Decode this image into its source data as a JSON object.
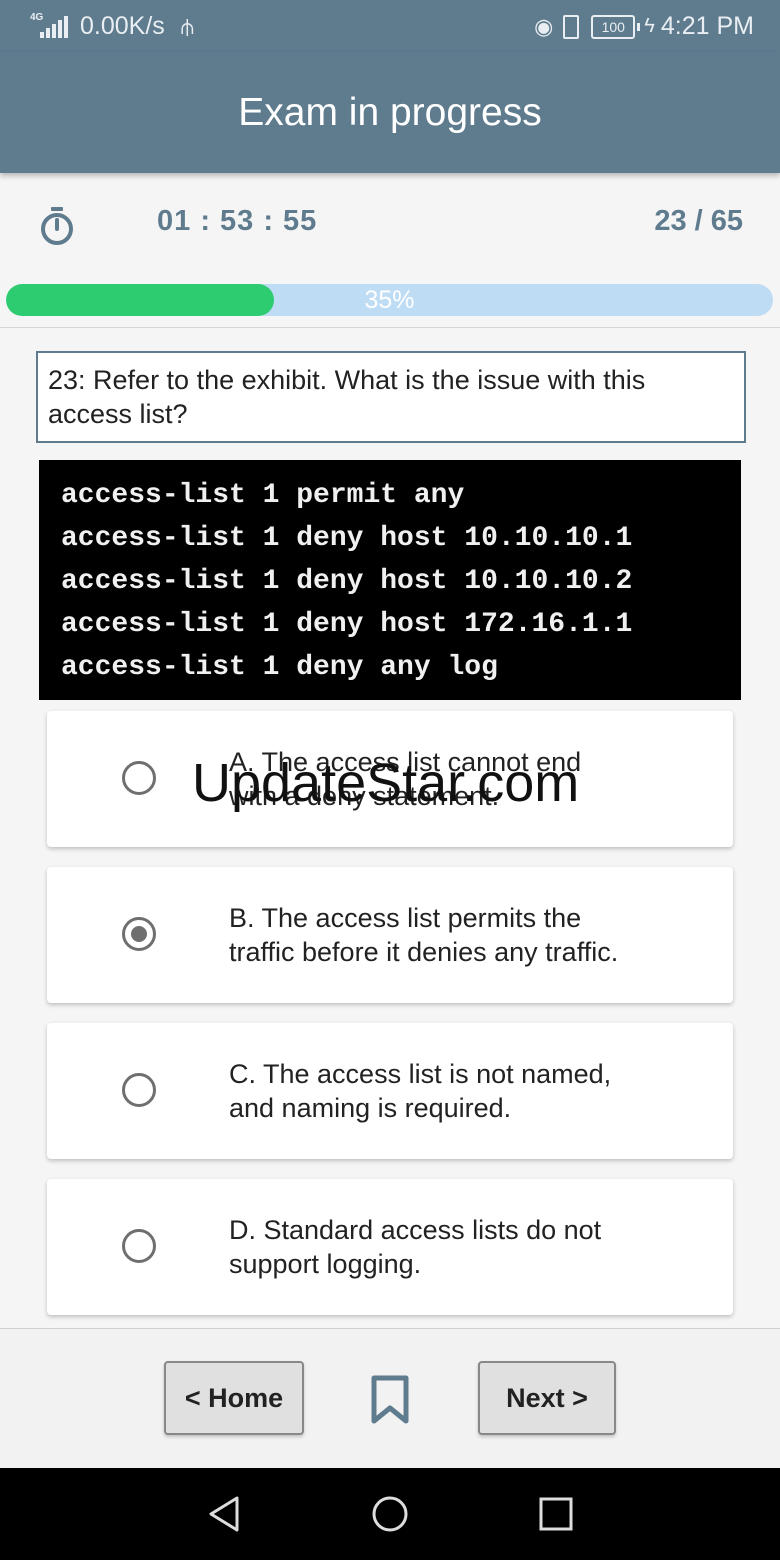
{
  "status_bar": {
    "network_type": "4G",
    "speed": "0.00K/s",
    "battery": "100",
    "time": "4:21 PM"
  },
  "header": {
    "title": "Exam in progress"
  },
  "info": {
    "timer": "01 : 53 : 55",
    "counter": "23 / 65"
  },
  "progress": {
    "value": 0.35,
    "label": "35%"
  },
  "question": {
    "text": "23: Refer to the exhibit. What is the issue with this access list?"
  },
  "exhibit": {
    "lines": [
      "access-list 1 permit any",
      "access-list 1 deny host 10.10.10.1",
      "access-list 1 deny host 10.10.10.2",
      "access-list 1 deny host 172.16.1.1",
      "access-list 1 deny any log"
    ]
  },
  "options": [
    {
      "line1": "A. The access list cannot end",
      "line2": "with a deny statement.",
      "selected": false
    },
    {
      "line1": "B. The access list permits the",
      "line2": "traffic before it denies any traffic.",
      "selected": true
    },
    {
      "line1": "C. The access list is not named,",
      "line2": "and naming is required.",
      "selected": false
    },
    {
      "line1": "D. Standard access lists do not",
      "line2": "support logging.",
      "selected": false
    }
  ],
  "watermark": "UpdateStar.com",
  "footer": {
    "home_label": "< Home",
    "next_label": "Next >"
  }
}
